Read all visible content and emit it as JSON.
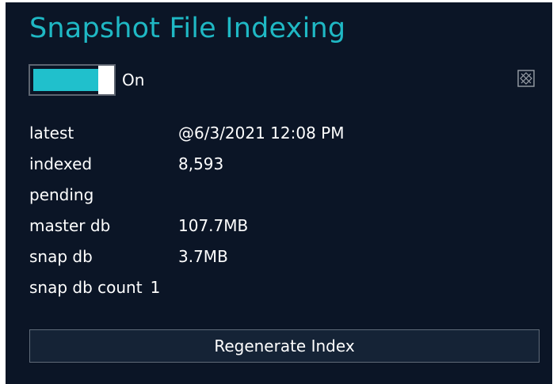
{
  "panel": {
    "title": "Snapshot File Indexing",
    "accent_color": "#1fb8c4",
    "background_color": "#0b1526"
  },
  "toggle": {
    "state": "On",
    "enabled": true
  },
  "close_icon": "close-box-icon",
  "stats": [
    {
      "label": "latest",
      "value": "@6/3/2021 12:08 PM"
    },
    {
      "label": "indexed",
      "value": "8,593"
    },
    {
      "label": "pending",
      "value": ""
    },
    {
      "label": "master db",
      "value": "107.7MB"
    },
    {
      "label": "snap db",
      "value": "3.7MB"
    },
    {
      "label": "snap db count",
      "value": "1"
    }
  ],
  "actions": {
    "regenerate_label": "Regenerate Index"
  }
}
